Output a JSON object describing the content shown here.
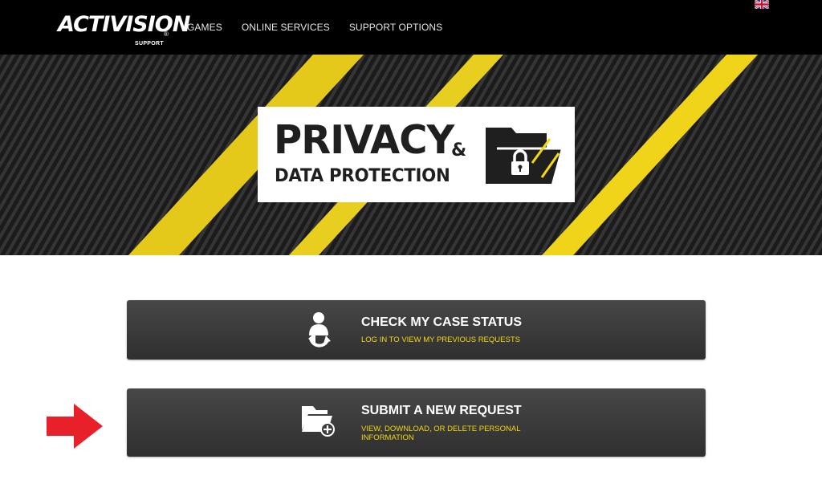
{
  "nav": {
    "logo_text": "ACTIVISION",
    "logo_reg": "®",
    "logo_sub": "SUPPORT",
    "links": [
      "GAMES",
      "ONLINE SERVICES",
      "SUPPORT OPTIONS"
    ]
  },
  "hero": {
    "title": "PRIVACY",
    "amp": "&",
    "subtitle": "DATA PROTECTION"
  },
  "actions": {
    "case_status": {
      "title": "CHECK MY CASE STATUS",
      "subtitle": "LOG IN TO VIEW MY PREVIOUS REQUESTS"
    },
    "new_request": {
      "title": "SUBMIT A NEW REQUEST",
      "subtitle": "VIEW, DOWNLOAD, OR DELETE PERSONAL INFORMATION"
    }
  },
  "colors": {
    "accent_yellow": "#f5d90a",
    "arrow_red": "#e8202a",
    "nav_bg": "#000000"
  },
  "icons": [
    "uk-flag-icon",
    "folder-lock-icon",
    "user-refresh-icon",
    "folder-add-icon",
    "red-arrow-icon"
  ]
}
